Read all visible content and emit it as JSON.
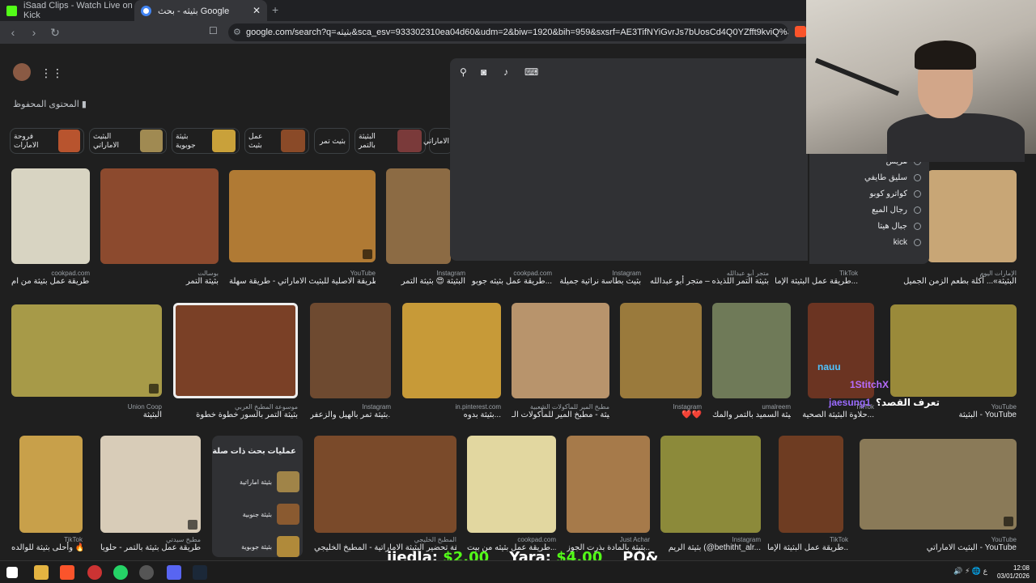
{
  "browser": {
    "tabs": [
      {
        "label": "iSaad Clips - Watch Live on Kick"
      },
      {
        "label": "بثيثه - بحث Google"
      }
    ],
    "url": "google.com/search?q=بثيثه&sca_esv=933302310ea04d60&udm=2&biw=1920&bih=959&sxsrf=AE3TifNYiGvrJs7bUosCd4Q0YZfft9kviQ%3A176743120877..."
  },
  "page": {
    "saved_label": "المحتوى المحفوظ",
    "chips": [
      "فروحة الامارات",
      "البثيث الاماراتي",
      "بثيثة جوبوية",
      "عمل بثيث",
      "بثيث تمر",
      "البثيثة بالتمر",
      "الاماراتي"
    ],
    "row1": [
      {
        "src": "cookpad.com",
        "title": "طريقة عمل بثيثة من ام..."
      },
      {
        "src": "بوسالت",
        "title": "بثيثة التمر"
      },
      {
        "src": "YouTube",
        "title": "الطريقة الاصلية للبثيث الاماراتي - طريقة سهلة ..."
      },
      {
        "src": "Instagram",
        "title": "البثيثة 😍 بثيثة التمر"
      },
      {
        "src": "cookpad.com",
        "title": "طريقة عمل بثيثه جوبو..."
      },
      {
        "src": "Instagram",
        "title": "بثيث بطاسة نراثية جميلة"
      },
      {
        "src": "متجر أبو عبدالله",
        "title": "بثيثة التمر اللذيذه – متجر أبو عبدالله"
      },
      {
        "src": "TikTok",
        "title": "طريقة عمل البثيثة الإما..."
      },
      {
        "src": "الإمارات اليوم",
        "title": "البثيثة»... أكلة بطعم الزمن الجميل"
      }
    ],
    "row2": [
      {
        "src": "Union Coop",
        "title": "البثيثة"
      },
      {
        "src": "موسوعة المطبخ العربي",
        "title": "بثيثة التمر بالسور خطوة خطوة"
      },
      {
        "src": "Instagram",
        "title": "بثيثة تمر بالهيل والزعفر..."
      },
      {
        "src": "in.pinterest.com",
        "title": "بثيثة بدوه..."
      },
      {
        "src": "مطبخ المير للمأكولات الشعبية",
        "title": "بثيثة - مطبخ المير للمأكولات الـ..."
      },
      {
        "src": "Instagram",
        "title": "❤️❤️"
      },
      {
        "src": "umalreem",
        "title": "بثيثة السميد بالتمر والمك..."
      },
      {
        "src": "TikTok",
        "title": "حلاوة البثيثة الصحية..."
      },
      {
        "src": "YouTube",
        "title": "البثيثة - YouTube"
      }
    ],
    "row3": [
      {
        "src": "TikTok",
        "title": "وأحلى بثيثة للوالده 🔥"
      },
      {
        "src": "مطبخ سيدتي",
        "title": "طريقة عمل بثيثة بالتمر - حلويا..."
      },
      {
        "src": "المطبخ الخليجي",
        "title": "طريقة تحضير البثيثة الاماراتية - المطبخ الخليجي"
      },
      {
        "src": "cookpad.com",
        "title": "طريقة عمل بثيثه من بيت..."
      },
      {
        "src": "Just Achar",
        "title": "بثيثة بالمادة بذرت الجوز..."
      },
      {
        "src": "Instagram",
        "title": "بثيثة الريم (@bethitht_alr..."
      },
      {
        "src": "TikTok",
        "title": "طريقة عمل البثيثة الإما..."
      },
      {
        "src": "YouTube",
        "title": "البثيث الاماراتي - YouTube"
      }
    ],
    "related": {
      "title": "عمليات بحث ذات صلة",
      "items": [
        "بثيثة اماراتية",
        "بثيثة جنوبية",
        "بثيثة جوبوية"
      ]
    },
    "suggestions": [
      "هريس",
      "سليق طايفي",
      "كواترو كوبو",
      "رجال الميع",
      "جبال هيتا",
      "kick"
    ]
  },
  "overlay": {
    "chat": [
      {
        "name": "nauu",
        "color": "#4fc3ff"
      },
      {
        "name": "1StitchX",
        "color": "#b66cff"
      },
      {
        "name": "jaesung1",
        "color": "#9b6bff"
      }
    ],
    "question": "تعرف القصد؟",
    "ticker": [
      {
        "name": "iiedla:",
        "amount": "$2.00"
      },
      {
        "name": "Yara:",
        "amount": "$4.00"
      },
      {
        "name": "PO&",
        "amount": ""
      }
    ]
  },
  "taskbar": {
    "time": "12:08",
    "date": "03/01/2026",
    "lang": "ع"
  }
}
